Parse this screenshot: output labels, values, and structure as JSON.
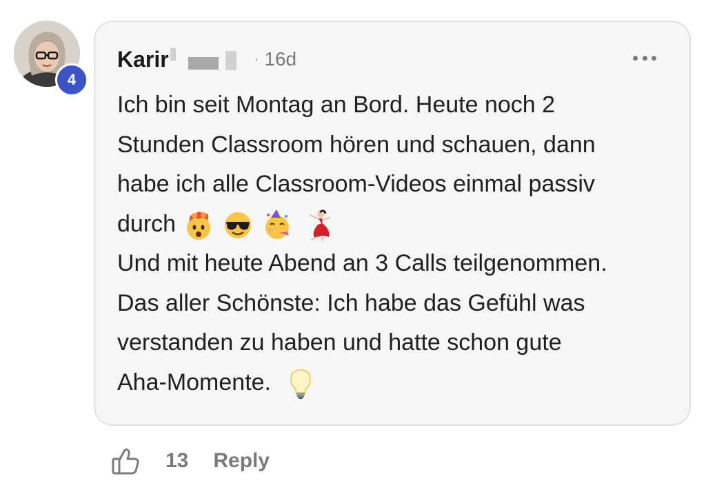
{
  "author": {
    "name": "Karir",
    "level": "4",
    "avatar_icon": "user-avatar-photo"
  },
  "comment": {
    "timestamp_separator": "·",
    "timestamp": "16d",
    "more_icon": "more-horizontal-icon",
    "lines": [
      "Ich bin seit Montag an Bord. Heute noch 2",
      "Stunden Classroom hören und schauen, dann",
      "habe ich alle Classroom-Videos einmal passiv",
      "durch",
      "Und mit heute Abend an 3 Calls teilgenommen.",
      "Das aller Schönste: Ich habe das Gefühl was",
      "verstanden zu haben und hatte schon gute",
      "Aha-Momente."
    ],
    "emojis": [
      "exploding-head-emoji",
      "sunglasses-face-emoji",
      "partying-face-emoji",
      "dancer-emoji",
      "light-bulb-emoji"
    ]
  },
  "actions": {
    "like_icon": "thumbs-up-icon",
    "like_count": "13",
    "reply_label": "Reply"
  },
  "colors": {
    "badge": "#3c53c6",
    "card_bg": "#f7f6f6",
    "card_border": "#e1e1e4",
    "muted_text": "#7b7b7b"
  }
}
